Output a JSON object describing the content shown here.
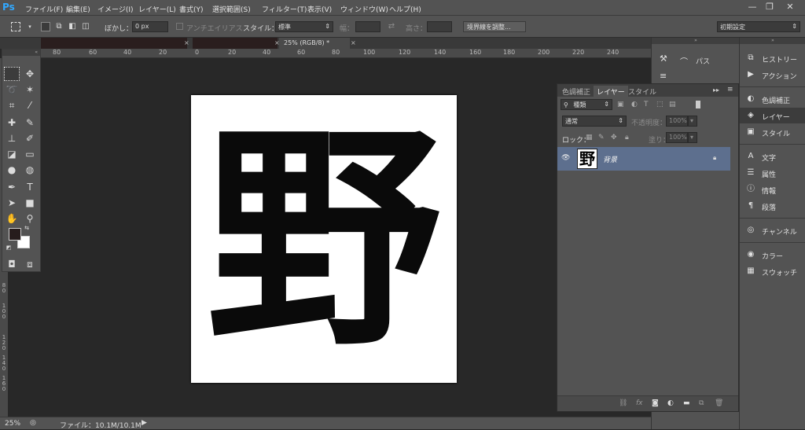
{
  "app": {
    "logo": "Ps"
  },
  "menu": [
    "ファイル(F)",
    "編集(E)",
    "イメージ(I)",
    "レイヤー(L)",
    "書式(Y)",
    "選択範囲(S)",
    "フィルター(T)",
    "表示(V)",
    "ウィンドウ(W)",
    "ヘルプ(H)"
  ],
  "window_controls": {
    "minimize": "—",
    "restore": "❐",
    "close": "✕"
  },
  "options": {
    "feather_label": "ぼかし：",
    "feather_value": "0 px",
    "antialias_label": "アンチエイリアス",
    "style_label": "スタイル：",
    "style_value": "標準",
    "width_label": "幅：",
    "height_label": "高さ：",
    "refine_edge": "境界線を調整...",
    "workspace": "初期設定"
  },
  "document": {
    "tab_title": "25% (RGB/8) *",
    "close_glyph": "×",
    "glyph": "野"
  },
  "ruler": {
    "top_ticks": [
      "80",
      "60",
      "40",
      "20",
      "0",
      "20",
      "40",
      "60",
      "80",
      "100",
      "120",
      "140",
      "160",
      "180",
      "200",
      "220",
      "240"
    ],
    "left_ticks": [
      "8\n0",
      "1\n0\n0",
      "1\n2\n0",
      "1\n4\n0",
      "1\n6\n0"
    ]
  },
  "status": {
    "zoom": "25%",
    "file_info": "ファイル：10.1M/10.1M"
  },
  "collapsed_panel": {
    "paths_label": "パス"
  },
  "layers_panel": {
    "tabs": [
      "色調補正",
      "レイヤー",
      "スタイル"
    ],
    "active_tab": "レイヤー",
    "filter_kind": "種類",
    "blend_mode": "通常",
    "opacity_label": "不透明度：",
    "opacity_value": "100%",
    "lock_label": "ロック：",
    "fill_label": "塗り：",
    "fill_value": "100%",
    "layer_name": "背景",
    "layer_thumb_glyph": "野"
  },
  "right_dock": [
    {
      "label": "ヒストリー",
      "icon": "history-icon",
      "glyph": "⧉"
    },
    {
      "label": "アクション",
      "icon": "play-icon",
      "glyph": "▶"
    },
    {
      "label": "色調補正",
      "icon": "adjustments-icon",
      "glyph": "◐"
    },
    {
      "label": "レイヤー",
      "icon": "layers-icon",
      "glyph": "◈"
    },
    {
      "label": "スタイル",
      "icon": "styles-icon",
      "glyph": "▣"
    },
    {
      "label": "文字",
      "icon": "character-icon",
      "glyph": "A"
    },
    {
      "label": "属性",
      "icon": "properties-icon",
      "glyph": "☰"
    },
    {
      "label": "情報",
      "icon": "info-icon",
      "glyph": "ⓘ"
    },
    {
      "label": "段落",
      "icon": "paragraph-icon",
      "glyph": "¶"
    },
    {
      "label": "チャンネル",
      "icon": "channels-icon",
      "glyph": "◎"
    },
    {
      "label": "カラー",
      "icon": "color-icon",
      "glyph": "◉"
    },
    {
      "label": "スウォッチ",
      "icon": "swatches-icon",
      "glyph": "▦"
    }
  ],
  "colors": {
    "foreground": "#261c1c",
    "background": "#ffffff",
    "layer_row_selected": "#5d6f8e",
    "logo": "#31a8ff"
  }
}
